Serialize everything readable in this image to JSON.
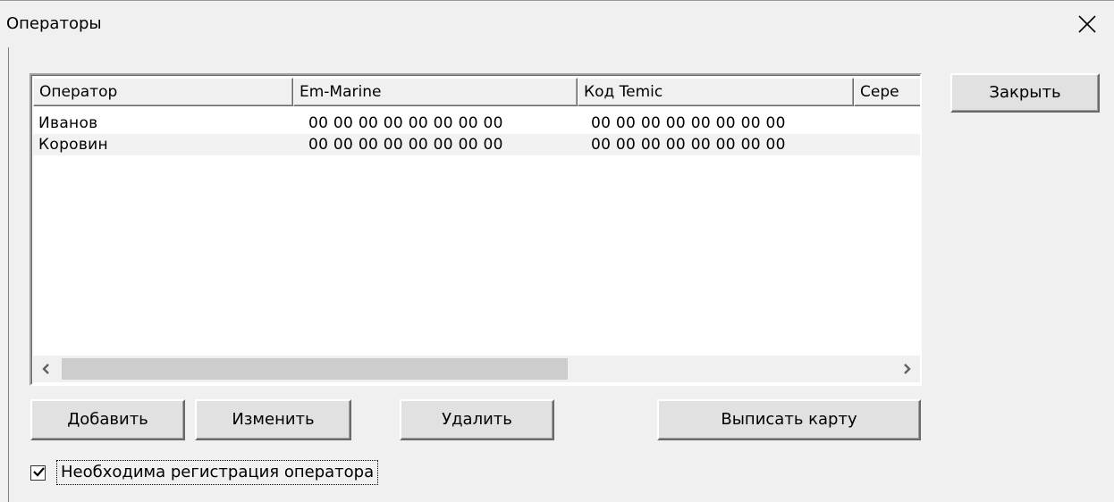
{
  "window": {
    "title": "Операторы"
  },
  "list": {
    "columns": [
      "Оператор",
      "Em-Marine",
      "Код Temic",
      "Сере"
    ],
    "rows": [
      {
        "operator": "Иванов",
        "em_marine": "00 00 00 00 00 00 00 00",
        "temic": "00 00 00 00 00 00 00 00"
      },
      {
        "operator": "Коровин",
        "em_marine": "00 00 00 00 00 00 00 00",
        "temic": "00 00 00 00 00 00 00 00"
      }
    ]
  },
  "buttons": {
    "close": "Закрыть",
    "add": "Добавить",
    "edit": "Изменить",
    "delete": "Удалить",
    "issue_card": "Выписать карту"
  },
  "options": {
    "registration_label": "Необходима регистрация оператора",
    "registration_checked": true
  },
  "icons": {
    "scroll_left": "chevron-left-icon",
    "scroll_right": "chevron-right-icon",
    "close": "close-icon",
    "check": "check-icon"
  }
}
